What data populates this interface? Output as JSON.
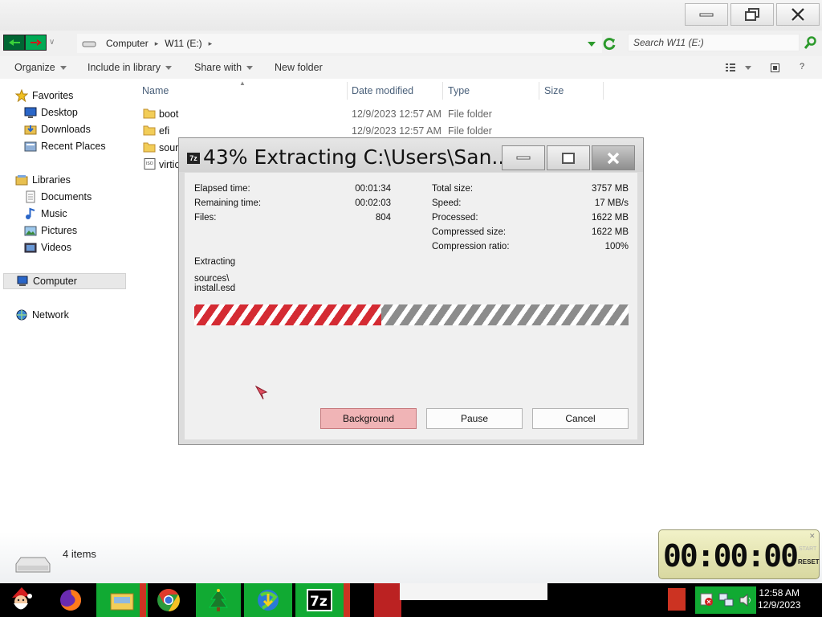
{
  "window": {
    "caption_buttons": {
      "minimize_icon": "minimize-icon",
      "restore_icon": "restore-icon",
      "close_icon": "close-icon"
    }
  },
  "address": {
    "crumbs": [
      "Computer",
      "W11 (E:)"
    ],
    "search_placeholder": "Search W11 (E:)"
  },
  "toolbar": {
    "organize": "Organize",
    "include_in_library": "Include in library",
    "share_with": "Share with",
    "new_folder": "New folder"
  },
  "nav": {
    "favorites": "Favorites",
    "desktop": "Desktop",
    "downloads": "Downloads",
    "recent_places": "Recent Places",
    "libraries": "Libraries",
    "documents": "Documents",
    "music": "Music",
    "pictures": "Pictures",
    "videos": "Videos",
    "computer": "Computer",
    "network": "Network"
  },
  "columns": {
    "name": "Name",
    "date_modified": "Date modified",
    "type": "Type",
    "size": "Size"
  },
  "files": [
    {
      "name": "boot",
      "date": "12/9/2023 12:57 AM",
      "type": "File folder",
      "icon": "folder-icon"
    },
    {
      "name": "efi",
      "date": "12/9/2023 12:57 AM",
      "type": "File folder",
      "icon": "folder-icon"
    },
    {
      "name": "sour",
      "date": "",
      "type": "",
      "icon": "folder-icon"
    },
    {
      "name": "virtic",
      "date": "",
      "type": "",
      "icon": "iso-file-icon"
    }
  ],
  "status": {
    "item_count": "4 items"
  },
  "dialog": {
    "title": "43% Extracting C:\\Users\\San...",
    "progress_fraction": 0.43,
    "stats_left": [
      {
        "label": "Elapsed time:",
        "value": "00:01:34"
      },
      {
        "label": "Remaining time:",
        "value": "00:02:03"
      },
      {
        "label": "Files:",
        "value": "804"
      }
    ],
    "stats_right": [
      {
        "label": "Total size:",
        "value": "3757 MB"
      },
      {
        "label": "Speed:",
        "value": "17 MB/s"
      },
      {
        "label": "Processed:",
        "value": "1622 MB"
      },
      {
        "label": "Compressed size:",
        "value": "1622 MB"
      },
      {
        "label": "Compression ratio:",
        "value": "100%"
      }
    ],
    "action": "Extracting",
    "current_path": "sources\\",
    "current_file": "install.esd",
    "buttons": {
      "background": "Background",
      "pause": "Pause",
      "cancel": "Cancel"
    },
    "colors": {
      "progress": "#d42b33",
      "remaining": "#8c8c8c"
    }
  },
  "timer": {
    "display": "00:00:00",
    "start": "START",
    "reset": "RESET"
  },
  "taskbar": {
    "apps": [
      "start-santa-icon",
      "firefox-icon",
      "file-explorer-icon",
      "chrome-icon",
      "christmas-tree-icon",
      "internet-download-manager-icon",
      "7zip-icon"
    ],
    "clock_time": "12:58 AM",
    "clock_date": "12/9/2023"
  }
}
